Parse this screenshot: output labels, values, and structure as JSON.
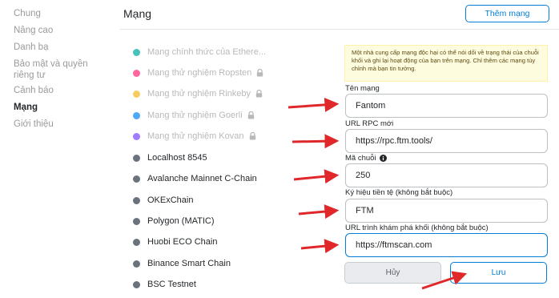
{
  "sidebar": {
    "items": [
      {
        "label": "Chung",
        "active": false
      },
      {
        "label": "Nâng cao",
        "active": false
      },
      {
        "label": "Danh bạ",
        "active": false
      },
      {
        "label": "Bảo mật và quyền riêng tư",
        "active": false
      },
      {
        "label": "Cảnh báo",
        "active": false
      },
      {
        "label": "Mạng",
        "active": true
      },
      {
        "label": "Giới thiệu",
        "active": false
      }
    ]
  },
  "header": {
    "title": "Mạng",
    "add_button": "Thêm mạng"
  },
  "networks": [
    {
      "label": "Mạng chính thức của Ethere...",
      "color": "#29b6af",
      "muted": true,
      "locked": false
    },
    {
      "label": "Mạng thử nghiệm Ropsten",
      "color": "#ff4a8d",
      "muted": true,
      "locked": true
    },
    {
      "label": "Mạng thử nghiệm Rinkeby",
      "color": "#f6c343",
      "muted": true,
      "locked": true
    },
    {
      "label": "Mạng thử nghiệm Goerli",
      "color": "#3099f2",
      "muted": true,
      "locked": true
    },
    {
      "label": "Mạng thử nghiệm Kovan",
      "color": "#9064ff",
      "muted": true,
      "locked": true
    },
    {
      "label": "Localhost 8545",
      "color": "#6a737d",
      "muted": false,
      "locked": false
    },
    {
      "label": "Avalanche Mainnet C-Chain",
      "color": "#6a737d",
      "muted": false,
      "locked": false
    },
    {
      "label": "OKExChain",
      "color": "#6a737d",
      "muted": false,
      "locked": false
    },
    {
      "label": "Polygon (MATIC)",
      "color": "#6a737d",
      "muted": false,
      "locked": false
    },
    {
      "label": "Huobi ECO Chain",
      "color": "#6a737d",
      "muted": false,
      "locked": false
    },
    {
      "label": "Binance Smart Chain",
      "color": "#6a737d",
      "muted": false,
      "locked": false
    },
    {
      "label": "BSC Testnet",
      "color": "#6a737d",
      "muted": false,
      "locked": false
    }
  ],
  "form": {
    "warning": "Một nhà cung cấp mạng độc hại có thể nói dối về trạng thái của chuỗi khối và ghi lại hoạt động của bạn trên mạng. Chỉ thêm các mạng tùy chỉnh mà bạn tin tưởng.",
    "network_name_label": "Tên mạng",
    "network_name_value": "Fantom",
    "rpc_label": "URL RPC mới",
    "rpc_value": "https://rpc.ftm.tools/",
    "chain_id_label": "Mã chuỗi",
    "chain_id_value": "250",
    "symbol_label": "Ký hiệu tiền tệ (không bắt buộc)",
    "symbol_value": "FTM",
    "explorer_label": "URL trình khám phá khối (không bắt buộc)",
    "explorer_value": "https://ftmscan.com",
    "cancel_button": "Hủy",
    "save_button": "Lưu"
  },
  "colors": {
    "accent": "#037dd6",
    "arrow": "#e0282b",
    "warning_bg": "#fefcde"
  }
}
